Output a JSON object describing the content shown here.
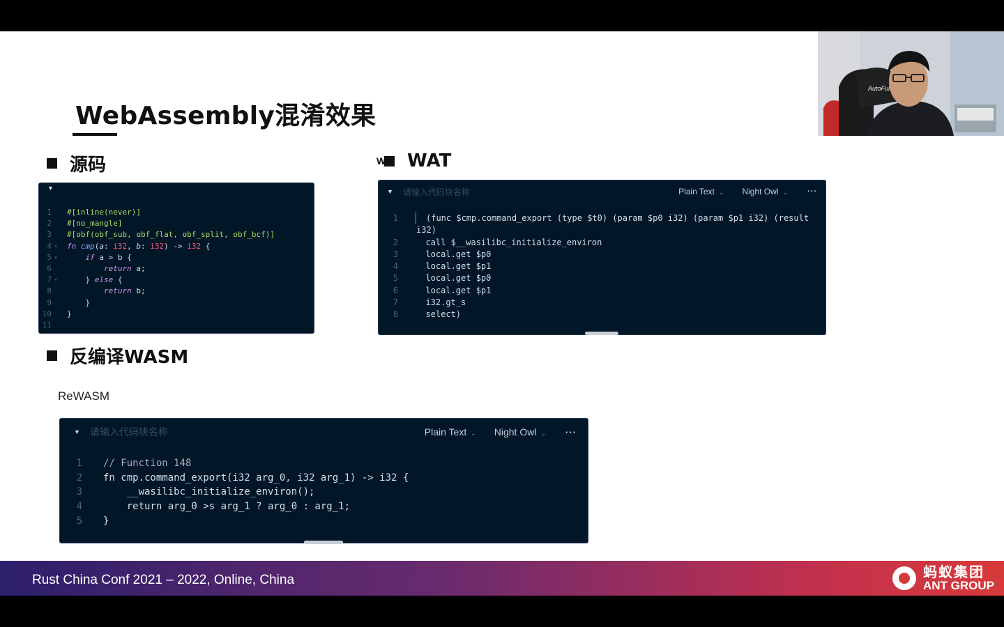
{
  "slide": {
    "title": "WebAssembly混淆效果",
    "section_source": "源码",
    "section_wat": "WAT",
    "section_decompile": "反编译WASM",
    "stray_text": "W",
    "rewasm_label": "ReWASM"
  },
  "source_panel": {
    "lines": [
      {
        "n": "1",
        "fold": "",
        "tokens": [
          {
            "t": "#[inline(never)]",
            "c": "attr"
          }
        ]
      },
      {
        "n": "2",
        "fold": "",
        "tokens": [
          {
            "t": "#[no_mangle]",
            "c": "attr"
          }
        ]
      },
      {
        "n": "3",
        "fold": "",
        "tokens": [
          {
            "t": "#[obf(obf_sub, obf_flat, obf_split, obf_bcf)]",
            "c": "attr"
          }
        ]
      },
      {
        "n": "4",
        "fold": "▾",
        "tokens": [
          {
            "t": "fn ",
            "c": "kw"
          },
          {
            "t": "cmp",
            "c": "fn"
          },
          {
            "t": "(",
            "c": "plain"
          },
          {
            "t": "a",
            "c": "param"
          },
          {
            "t": ": ",
            "c": "plain"
          },
          {
            "t": "i32",
            "c": "type"
          },
          {
            "t": ", ",
            "c": "plain"
          },
          {
            "t": "b",
            "c": "param"
          },
          {
            "t": ": ",
            "c": "plain"
          },
          {
            "t": "i32",
            "c": "type"
          },
          {
            "t": ") -> ",
            "c": "plain"
          },
          {
            "t": "i32",
            "c": "type"
          },
          {
            "t": " {",
            "c": "plain"
          }
        ]
      },
      {
        "n": "5",
        "fold": "▾",
        "tokens": [
          {
            "t": "    ",
            "c": "plain"
          },
          {
            "t": "if",
            "c": "kw"
          },
          {
            "t": " a > b {",
            "c": "plain"
          }
        ]
      },
      {
        "n": "6",
        "fold": "",
        "tokens": [
          {
            "t": "        ",
            "c": "plain"
          },
          {
            "t": "return",
            "c": "ret"
          },
          {
            "t": " a;",
            "c": "plain"
          }
        ]
      },
      {
        "n": "7",
        "fold": "▾",
        "tokens": [
          {
            "t": "    } ",
            "c": "plain"
          },
          {
            "t": "else",
            "c": "kw"
          },
          {
            "t": " {",
            "c": "plain"
          }
        ]
      },
      {
        "n": "8",
        "fold": "",
        "tokens": [
          {
            "t": "        ",
            "c": "plain"
          },
          {
            "t": "return",
            "c": "ret"
          },
          {
            "t": " b;",
            "c": "plain"
          }
        ]
      },
      {
        "n": "9",
        "fold": "",
        "tokens": [
          {
            "t": "    }",
            "c": "plain"
          }
        ]
      },
      {
        "n": "10",
        "fold": "",
        "tokens": [
          {
            "t": "}",
            "c": "plain"
          }
        ]
      },
      {
        "n": "11",
        "fold": "",
        "tokens": [
          {
            "t": "",
            "c": "plain"
          }
        ]
      }
    ]
  },
  "wat_panel": {
    "placeholder": "请输入代码块名称",
    "language": "Plain Text",
    "theme": "Night Owl",
    "more": "···",
    "lines": [
      {
        "n": "1",
        "text": "(func $cmp.command_export (type $t0) (param $p0 i32) (param $p1 i32) (result"
      },
      {
        "n": "",
        "text": "i32)"
      },
      {
        "n": "2",
        "text": "  call $__wasilibc_initialize_environ"
      },
      {
        "n": "3",
        "text": "  local.get $p0"
      },
      {
        "n": "4",
        "text": "  local.get $p1"
      },
      {
        "n": "5",
        "text": "  local.get $p0"
      },
      {
        "n": "6",
        "text": "  local.get $p1"
      },
      {
        "n": "7",
        "text": "  i32.gt_s"
      },
      {
        "n": "8",
        "text": "  select)"
      }
    ]
  },
  "rewasm_panel": {
    "placeholder": "请输入代码块名称",
    "language": "Plain Text",
    "theme": "Night Owl",
    "more": "···",
    "lines": [
      {
        "n": "1",
        "text": "// Function 148",
        "c": "comment"
      },
      {
        "n": "2",
        "text": "fn cmp.command_export(i32 arg_0, i32 arg_1) -> i32 {",
        "c": "plain"
      },
      {
        "n": "3",
        "text": "    __wasilibc_initialize_environ();",
        "c": "plain"
      },
      {
        "n": "4",
        "text": "    return arg_0 >s arg_1 ? arg_0 : arg_1;",
        "c": "plain"
      },
      {
        "n": "5",
        "text": "}",
        "c": "plain"
      }
    ]
  },
  "footer": {
    "conference": "Rust China Conf 2021 – 2022, Online, China",
    "logo_cn": "蚂蚁集团",
    "logo_en": "ANT GROUP"
  },
  "webcam": {
    "chair_brand": "AutoFull"
  },
  "colors": {
    "code_bg": "#011627",
    "keyword": "#c792ea",
    "function": "#82aaff",
    "type": "#ff5874",
    "attribute": "#addb67"
  }
}
